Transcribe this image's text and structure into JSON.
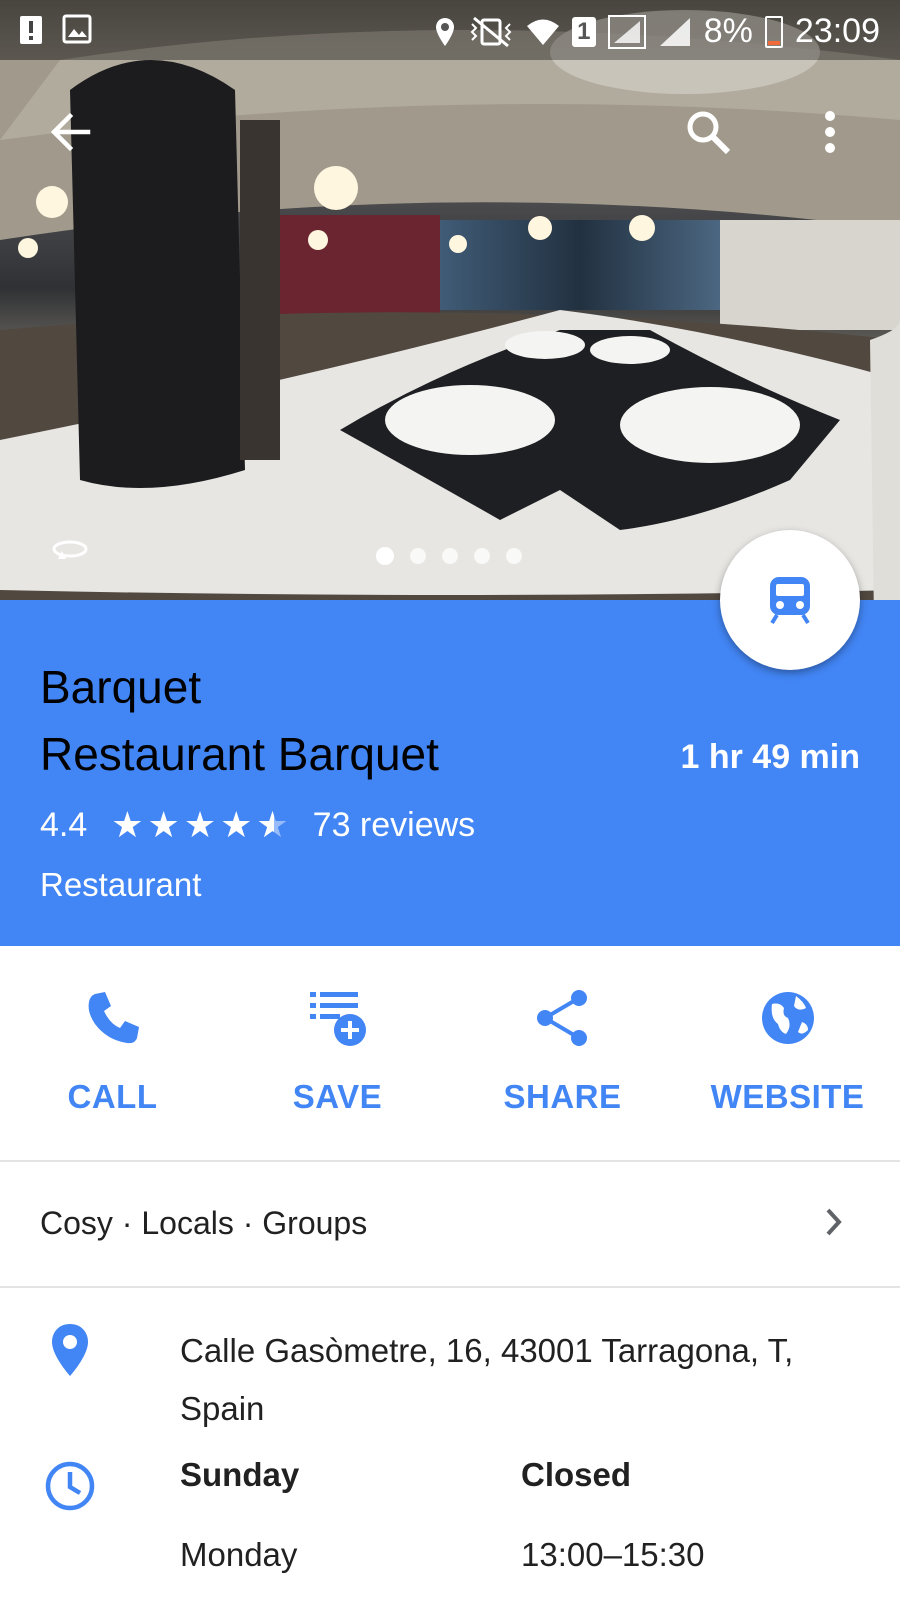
{
  "status_bar": {
    "battery_percent": "8%",
    "time": "23:09",
    "sim_label": "1"
  },
  "hero": {
    "photo_count": 5,
    "active_photo_index": 0
  },
  "place": {
    "name_line1": "Barquet",
    "name_line2": "Restaurant Barquet",
    "travel_time": "1 hr 49 min",
    "travel_mode_icon": "train-icon",
    "rating": "4.4",
    "rating_value": 4.4,
    "stars_max": 5,
    "reviews": "73 reviews",
    "category": "Restaurant"
  },
  "actions": [
    {
      "label": "CALL",
      "icon": "phone-icon"
    },
    {
      "label": "SAVE",
      "icon": "playlist-add-icon"
    },
    {
      "label": "SHARE",
      "icon": "share-icon"
    },
    {
      "label": "WEBSITE",
      "icon": "globe-icon"
    }
  ],
  "tags": "Cosy · Locals · Groups",
  "address": "Calle Gasòmetre, 16, 43001 Tarragona, T, Spain",
  "hours": [
    {
      "day": "Sunday",
      "time": "Closed",
      "today": true
    },
    {
      "day": "Monday",
      "time": "13:00–15:30",
      "today": false
    }
  ],
  "colors": {
    "primary": "#4285f4",
    "text": "#212121",
    "divider": "#e3e3e3"
  }
}
